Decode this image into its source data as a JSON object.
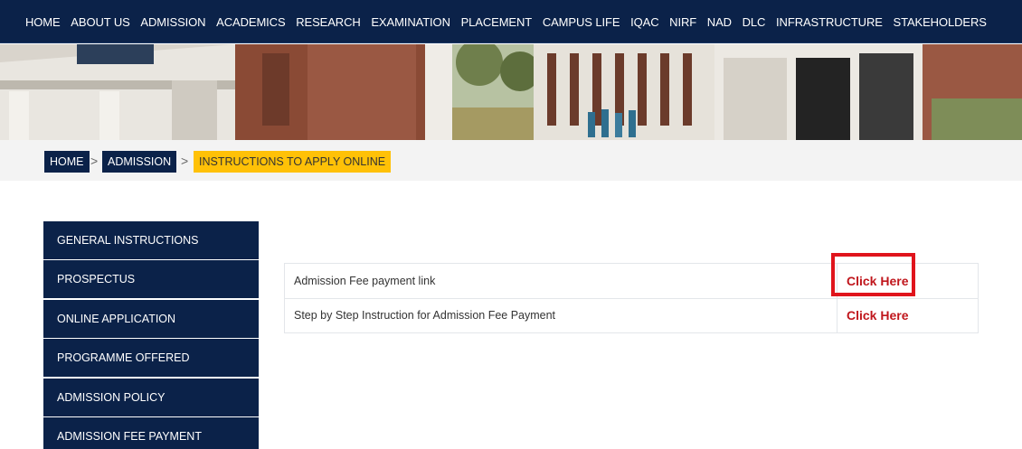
{
  "nav": {
    "items": [
      "HOME",
      "ABOUT US",
      "ADMISSION",
      "ACADEMICS",
      "RESEARCH",
      "EXAMINATION",
      "PLACEMENT",
      "CAMPUS LIFE",
      "IQAC",
      "NIRF",
      "NAD",
      "DLC",
      "INFRASTRUCTURE",
      "STAKEHOLDERS"
    ]
  },
  "breadcrumb": {
    "home": "HOME",
    "admission": "ADMISSION",
    "current": "INSTRUCTIONS TO APPLY ONLINE",
    "separator": ">"
  },
  "sidebar": {
    "items": [
      "GENERAL INSTRUCTIONS",
      "PROSPECTUS",
      "ONLINE APPLICATION",
      "PROGRAMME OFFERED",
      "ADMISSION POLICY",
      "ADMISSION FEE PAYMENT"
    ]
  },
  "table": {
    "rows": [
      {
        "label": "Admission Fee payment link",
        "link": "Click Here"
      },
      {
        "label": "Step by Step Instruction for Admission Fee Payment",
        "link": "Click Here"
      }
    ]
  },
  "colors": {
    "navy": "#0b2249",
    "yellow": "#ffc107",
    "link_red": "#c0161c",
    "highlight_red": "#e0141c"
  }
}
